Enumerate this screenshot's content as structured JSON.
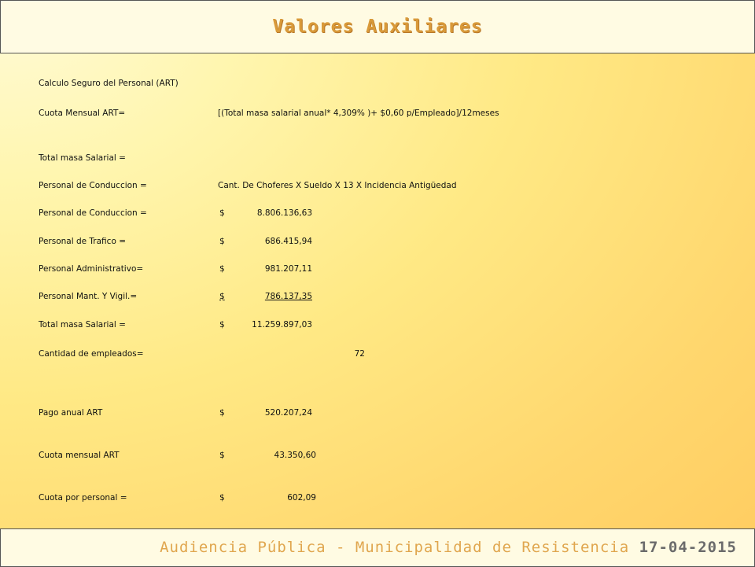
{
  "header": {
    "title": "Valores Auxiliares"
  },
  "footer": {
    "organization": "Audiencia Pública - Municipalidad de Resistencia",
    "date": "17-04-2015"
  },
  "section_title": "Calculo Seguro del Personal (ART)",
  "formula": {
    "label": "Cuota Mensual ART=",
    "expression": "[(Total masa salarial anual* 4,309% )+ $0,60 p/Empleado]/12meses"
  },
  "total_masa_heading": "Total masa Salarial =",
  "conduccion_formula": {
    "label": "Personal de Conduccion =",
    "expression": "Cant. De Choferes X Sueldo X 13 X Incidencia Antigüedad"
  },
  "currency_symbol": "$",
  "salaries": [
    {
      "label": "Personal de Conduccion =",
      "amount": "8.806.136,63"
    },
    {
      "label": "Personal de Trafico =",
      "amount": "686.415,94"
    },
    {
      "label": "Personal Administrativo=",
      "amount": "981.207,11"
    },
    {
      "label": "Personal Mant. Y Vigil.=",
      "amount": "786.137,35"
    }
  ],
  "total_masa": {
    "label": "Total masa Salarial =",
    "amount": "11.259.897,03"
  },
  "employees": {
    "label": "Cantidad de empleados=",
    "value": "72"
  },
  "results": [
    {
      "label": "Pago anual ART",
      "amount": "520.207,24"
    },
    {
      "label": "Cuota mensual ART",
      "amount": "43.350,60"
    },
    {
      "label": "Cuota por personal =",
      "amount": "602,09"
    }
  ]
}
